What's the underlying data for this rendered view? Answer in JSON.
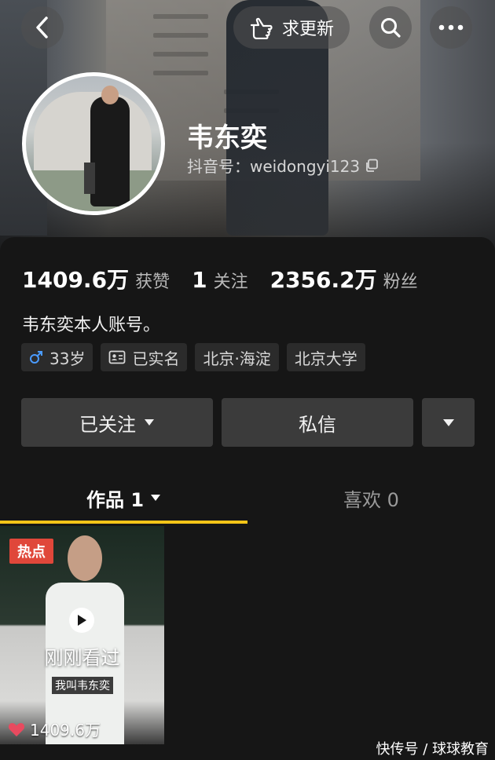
{
  "header": {
    "update_label": "求更新",
    "back_icon": "chevron-left-icon",
    "search_icon": "search-icon",
    "more_icon": "more-icon",
    "update_icon": "pointing-hand-icon"
  },
  "profile": {
    "name": "韦东奕",
    "douyin_id": "抖音号：weidongyi123",
    "bio": "韦东奕本人账号。"
  },
  "stats": [
    {
      "num": "1409.6万",
      "label": "获赞"
    },
    {
      "num": "1",
      "label": "关注"
    },
    {
      "num": "2356.2万",
      "label": "粉丝"
    }
  ],
  "tags": {
    "age": "33岁",
    "verified": "已实名",
    "location": "北京·海淀",
    "school": "北京大学"
  },
  "actions": {
    "followed": "已关注",
    "message": "私信"
  },
  "tabs": {
    "works": "作品 1",
    "likes": "喜欢 0"
  },
  "video": {
    "badge": "热点",
    "recent": "刚刚看过",
    "caption": "我叫韦东奕",
    "likes": "1409.6万"
  },
  "watermark": "快传号 / 球球教育",
  "colors": {
    "accent": "#f5c518",
    "badge": "#e0473a",
    "male": "#4a9bff"
  }
}
